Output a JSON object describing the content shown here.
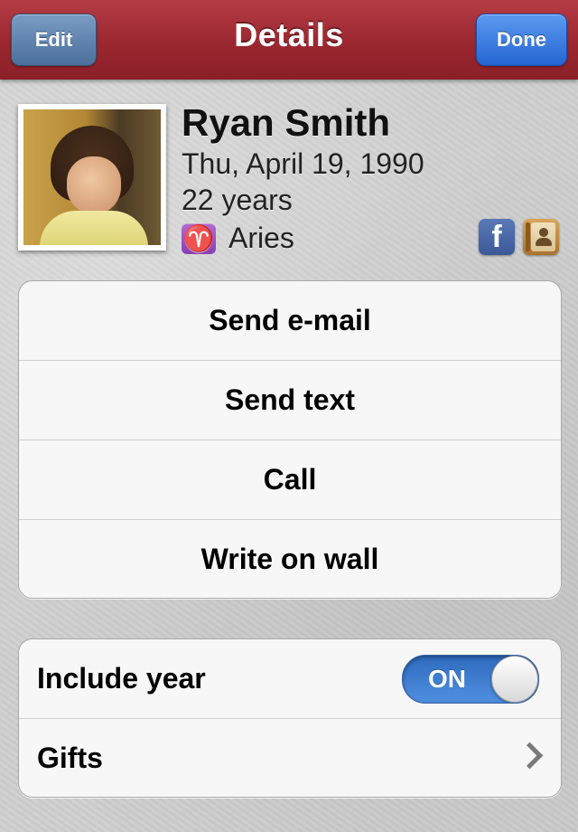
{
  "navbar": {
    "title": "Details",
    "edit_label": "Edit",
    "done_label": "Done"
  },
  "profile": {
    "name": "Ryan Smith",
    "birthdate": "Thu, April 19, 1990",
    "age": "22 years",
    "sign_symbol": "♈",
    "sign": "Aries",
    "icons": [
      "facebook-icon",
      "contacts-icon"
    ]
  },
  "actions": [
    {
      "label": "Send e-mail"
    },
    {
      "label": "Send text"
    },
    {
      "label": "Call"
    },
    {
      "label": "Write on wall"
    }
  ],
  "settings": {
    "include_year_label": "Include year",
    "toggle_state": "ON",
    "gifts_label": "Gifts"
  },
  "colors": {
    "navbar": "#9b2730",
    "done_button": "#2565d3",
    "toggle_on": "#2f6bbf",
    "facebook": "#3b5998"
  }
}
